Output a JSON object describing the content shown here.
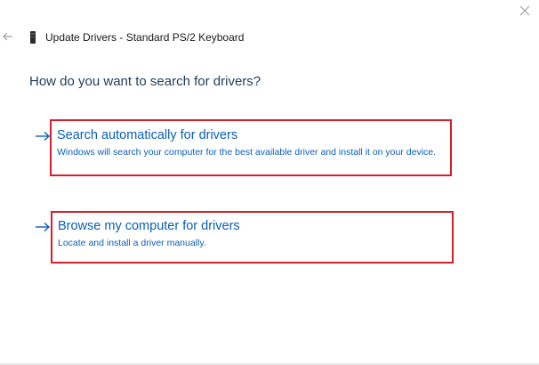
{
  "window": {
    "title": "Update Drivers - Standard PS/2 Keyboard",
    "heading": "How do you want to search for drivers?",
    "back_icon": "back-arrow-icon",
    "close_icon": "close-icon",
    "device_icon": "keyboard-device-icon"
  },
  "options": [
    {
      "title": "Search automatically for drivers",
      "description": "Windows will search your computer for the best available driver and install it on your device.",
      "icon": "right-arrow-icon",
      "highlighted": true
    },
    {
      "title": "Browse my computer for drivers",
      "description": "Locate and install a driver manually.",
      "icon": "right-arrow-icon",
      "highlighted": true
    }
  ],
  "colors": {
    "link_blue": "#0a5fb4",
    "heading_blue": "#1e3c5a",
    "highlight_red": "#d51f2a"
  }
}
